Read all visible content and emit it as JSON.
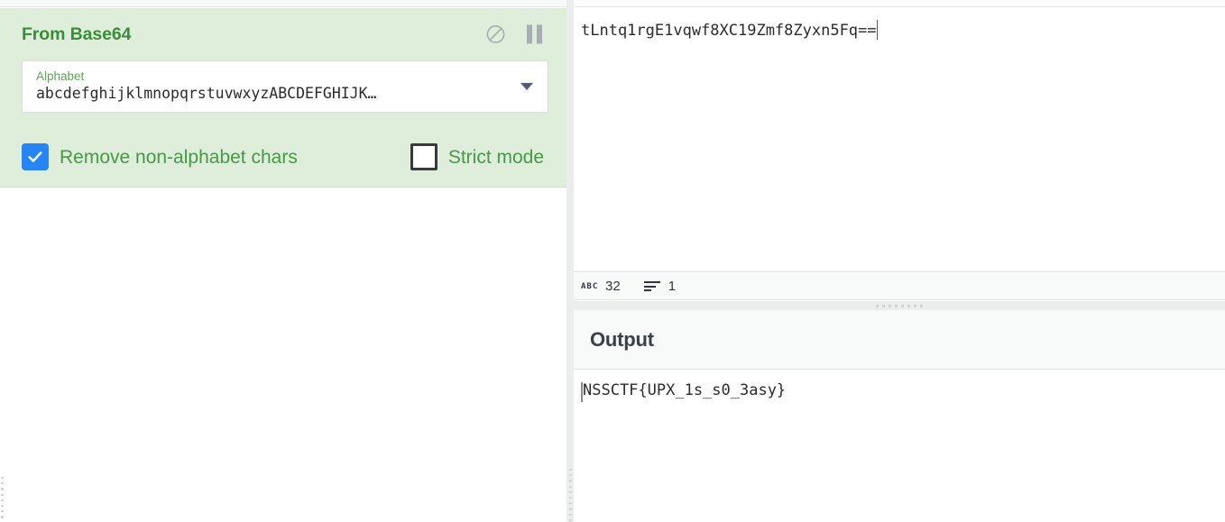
{
  "colors": {
    "operation_bg": "#dfeeda",
    "operation_title": "#3a8d3a",
    "arg_label": "#5fa25f",
    "checkbox_checked": "#2684f5",
    "checkbox_label": "#469946",
    "panel_header_bg": "#f8f9f9",
    "text_dark": "#2b2b2b",
    "gutter": "#eceded"
  },
  "recipe": {
    "operation": {
      "title": "From Base64",
      "disable_icon": "circle-slash-icon",
      "pause_icon": "pause-icon",
      "argument": {
        "label": "Alphabet",
        "value": "abcdefghijklmnopqrstuvwxyzABCDEFGHIJK…",
        "dropdown_icon": "chevron-down-icon"
      },
      "checkboxes": [
        {
          "label": "Remove non-alphabet chars",
          "checked": true
        },
        {
          "label": "Strict mode",
          "checked": false
        }
      ]
    }
  },
  "input": {
    "value": "tLntq1rgE1vqwf8XC19Zmf8Zyxn5Fq==",
    "status": {
      "length_icon": "abc-icon",
      "length_value": "32",
      "lines_icon": "lines-icon",
      "lines_value": "1"
    }
  },
  "output": {
    "title": "Output",
    "value": "NSSCTF{UPX_1s_s0_3asy}"
  }
}
